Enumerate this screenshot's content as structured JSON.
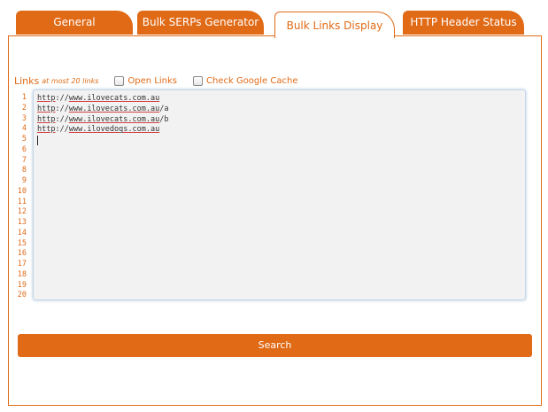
{
  "tabs": [
    {
      "label": "General"
    },
    {
      "label": "Bulk SERPs Generator"
    },
    {
      "label": "Bulk Links Display"
    },
    {
      "label": "HTTP Header Status"
    }
  ],
  "active_tab": "Bulk Links Display",
  "links_section": {
    "title": "Links",
    "hint": "at most 20 links",
    "open_links_label": "Open Links",
    "check_cache_label": "Check Google Cache",
    "open_links_checked": false,
    "check_cache_checked": false
  },
  "editor": {
    "line_numbers": [
      "1",
      "2",
      "3",
      "4",
      "5",
      "6",
      "7",
      "8",
      "9",
      "10",
      "11",
      "12",
      "13",
      "14",
      "15",
      "16",
      "17",
      "18",
      "19",
      "20"
    ],
    "lines": [
      {
        "scheme": "http",
        "sep": "://",
        "host": "www.ilovecats.com.au",
        "path": ""
      },
      {
        "scheme": "http",
        "sep": "://",
        "host": "www.ilovecats.com.au",
        "path": "/a"
      },
      {
        "scheme": "http",
        "sep": "://",
        "host": "www.ilovecats.com.au",
        "path": "/b"
      },
      {
        "scheme": "http",
        "sep": "://",
        "host": "www.ilovedogs.com.au",
        "path": ""
      }
    ]
  },
  "search_button_label": "Search",
  "colors": {
    "accent": "#e06a16",
    "editor_bg": "#f2f2f2",
    "editor_border": "#c5d8ea"
  }
}
